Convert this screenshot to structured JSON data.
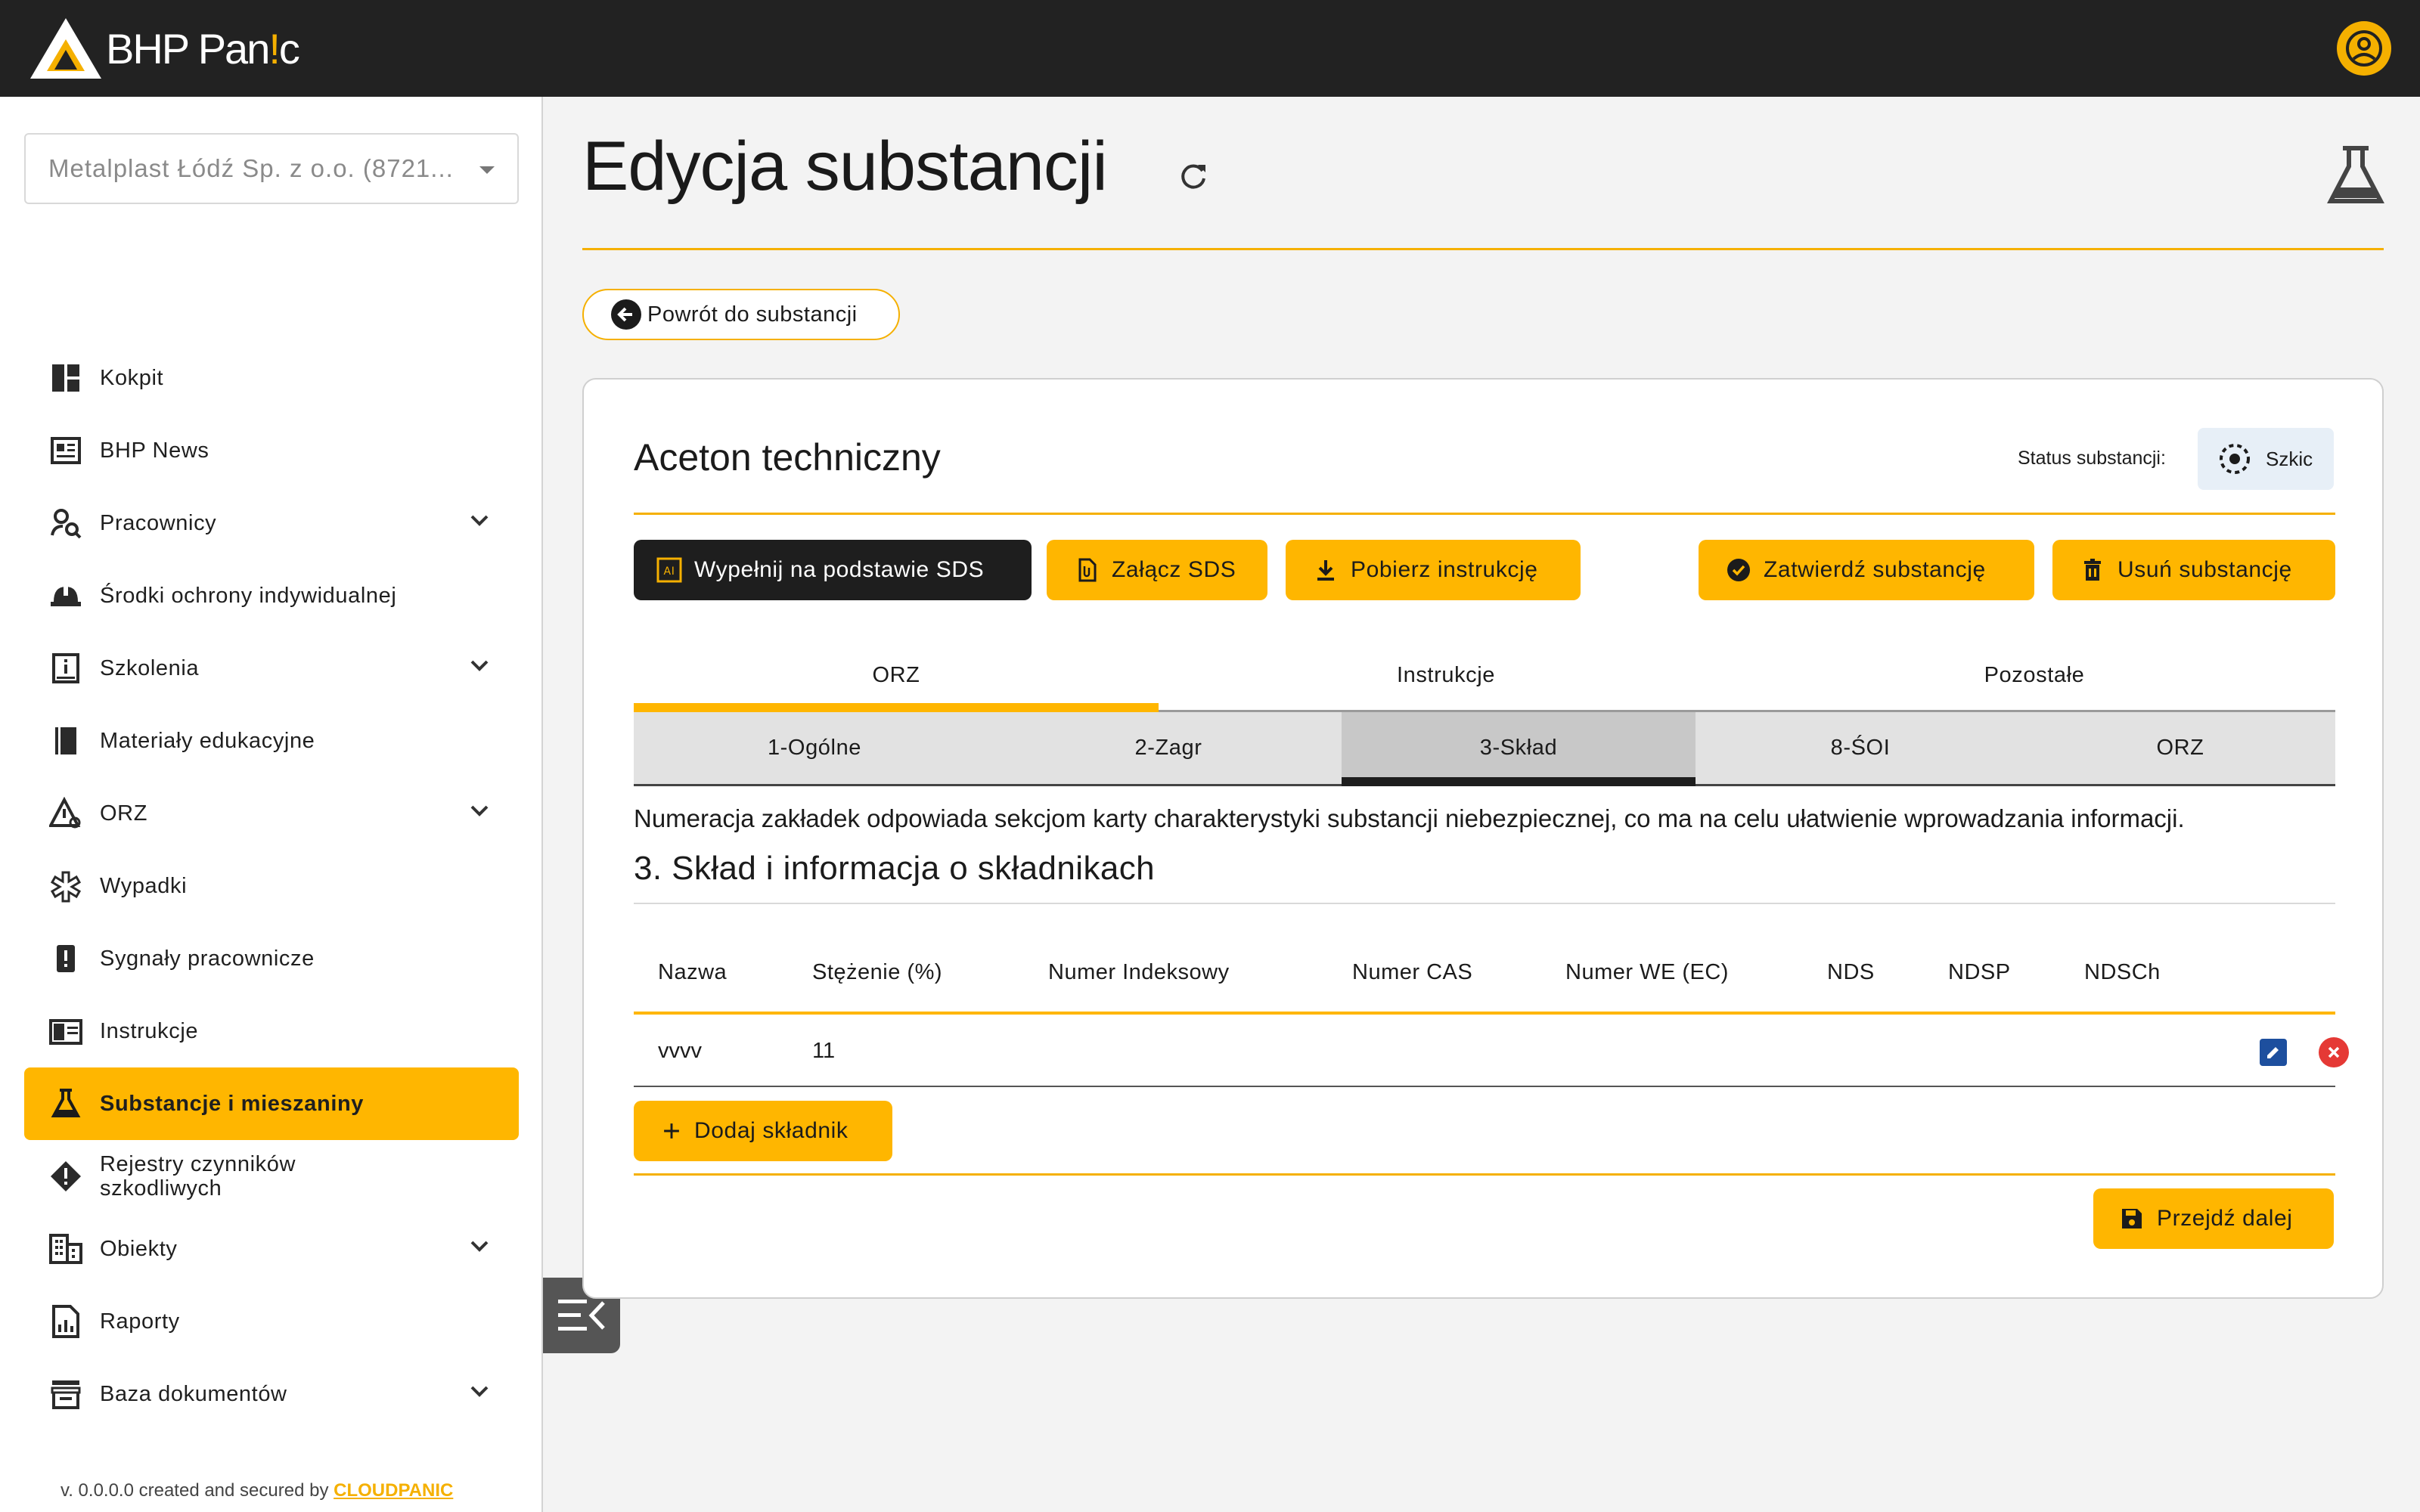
{
  "app": {
    "logo_text_prefix": "BHP Pan",
    "logo_text_accent": "!",
    "logo_text_suffix": "c"
  },
  "sidebar": {
    "company_select_value": "Metalplast Łódź Sp. z o.o. (8721...",
    "items": [
      {
        "label": "Kokpit",
        "icon": "dashboard-icon",
        "expandable": false
      },
      {
        "label": "BHP News",
        "icon": "news-icon",
        "expandable": false
      },
      {
        "label": "Pracownicy",
        "icon": "employee-search-icon",
        "expandable": true
      },
      {
        "label": "Środki ochrony indywidualnej",
        "icon": "helmet-icon",
        "expandable": false
      },
      {
        "label": "Szkolenia",
        "icon": "training-icon",
        "expandable": true
      },
      {
        "label": "Materiały edukacyjne",
        "icon": "book-icon",
        "expandable": false
      },
      {
        "label": "ORZ",
        "icon": "risk-icon",
        "expandable": true
      },
      {
        "label": "Wypadki",
        "icon": "medical-icon",
        "expandable": false
      },
      {
        "label": "Sygnały pracownicze",
        "icon": "alert-icon",
        "expandable": false
      },
      {
        "label": "Instrukcje",
        "icon": "instructions-icon",
        "expandable": false
      },
      {
        "label": "Substancje i mieszaniny",
        "icon": "flask-icon",
        "expandable": false,
        "active": true
      },
      {
        "label_line1": "Rejestry czynników",
        "label_line2": "szkodliwych",
        "icon": "warning-diamond-icon",
        "expandable": false
      },
      {
        "label": "Obiekty",
        "icon": "building-icon",
        "expandable": true
      },
      {
        "label": "Raporty",
        "icon": "report-icon",
        "expandable": false
      },
      {
        "label": "Baza dokumentów",
        "icon": "archive-icon",
        "expandable": true
      }
    ],
    "footer_text": "v. 0.0.0.0 created and secured by ",
    "footer_link": "CLOUDPANIC"
  },
  "page": {
    "title": "Edycja substancji",
    "back_button": "Powrót do substancji"
  },
  "card": {
    "substance_name": "Aceton techniczny",
    "status_label": "Status substancji:",
    "status_value": "Szkic",
    "buttons": {
      "fill_sds": "Wypełnij na podstawie SDS",
      "attach_sds": "Załącz SDS",
      "download_instruction": "Pobierz instrukcję",
      "approve": "Zatwierdź substancję",
      "delete": "Usuń substancję"
    },
    "main_tabs": [
      "ORZ",
      "Instrukcje",
      "Pozostałe"
    ],
    "sub_tabs": [
      "1-Ogólne",
      "2-Zagr",
      "3-Skład",
      "8-ŚOI",
      "ORZ"
    ],
    "info_text": "Numeracja zakładek odpowiada sekcjom karty charakterystyki substancji niebezpiecznej, co ma na celu ułatwienie wprowadzania informacji.",
    "section_title": "3. Skład i informacja o składnikach",
    "table": {
      "headers": [
        "Nazwa",
        "Stężenie (%)",
        "Numer Indeksowy",
        "Numer CAS",
        "Numer WE (EC)",
        "NDS",
        "NDSP",
        "NDSCh"
      ],
      "rows": [
        [
          "vvvv",
          "11",
          "",
          "",
          "",
          "",
          "",
          ""
        ]
      ]
    },
    "add_component": "Dodaj składnik",
    "next": "Przejdź dalej"
  },
  "colors": {
    "accent": "#ffb600",
    "topbar": "#222222",
    "edit": "#1d4f9e",
    "delete": "#e53935"
  }
}
